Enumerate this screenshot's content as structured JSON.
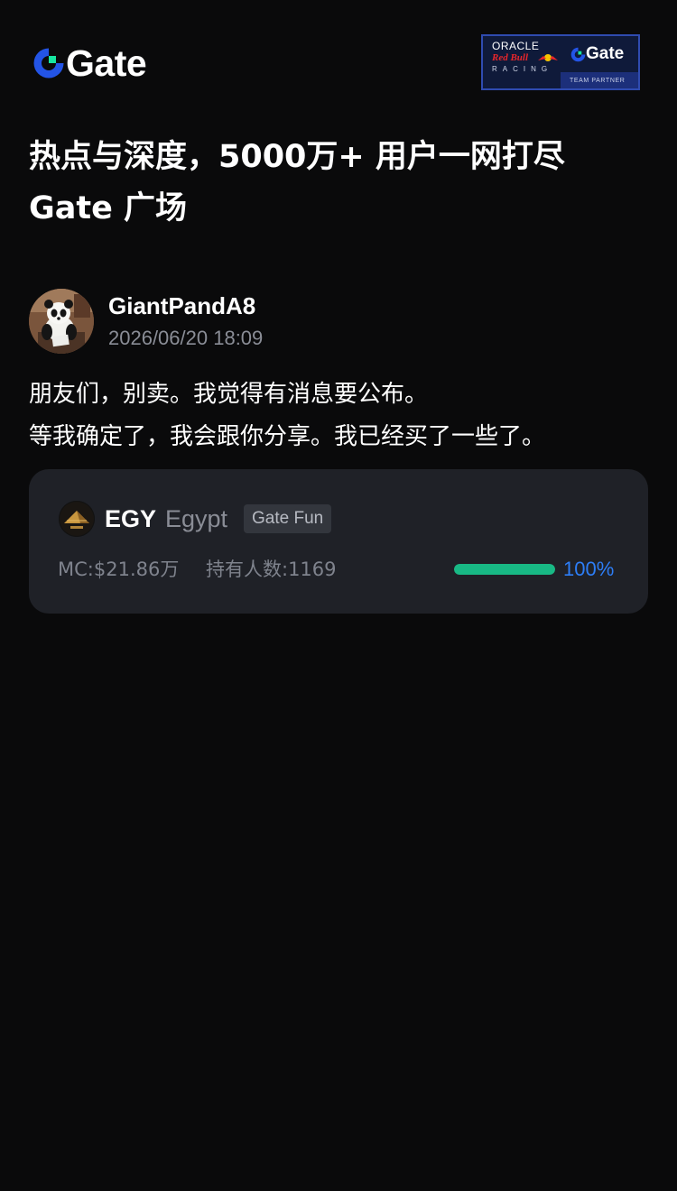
{
  "brand": {
    "logo_text": "Gate",
    "accent_blue": "#2354e6",
    "accent_green": "#17e6a1"
  },
  "partner_badge": {
    "line1": "ORACLE",
    "line2": "Red Bull",
    "line3": "RACING",
    "gate_text": "Gate",
    "footer": "TEAM PARTNER"
  },
  "headline": {
    "line1": "热点与深度，5000万+ 用户一网打尽",
    "line2": "Gate 广场"
  },
  "post": {
    "author": "GiantPandA8",
    "timestamp": "2026/06/20 18:09",
    "body_line1": "朋友们，别卖。我觉得有消息要公布。",
    "body_line2": "等我确定了，我会跟你分享。我已经买了一些了。"
  },
  "token_card": {
    "symbol": "EGY",
    "name": "Egypt",
    "tag": "Gate Fun",
    "market_cap": "MC:$21.86万",
    "holders": "持有人数:1169",
    "progress_percent": 100,
    "progress_label": "100%",
    "progress_color": "#18b985",
    "progress_label_color": "#2d7ef7"
  }
}
